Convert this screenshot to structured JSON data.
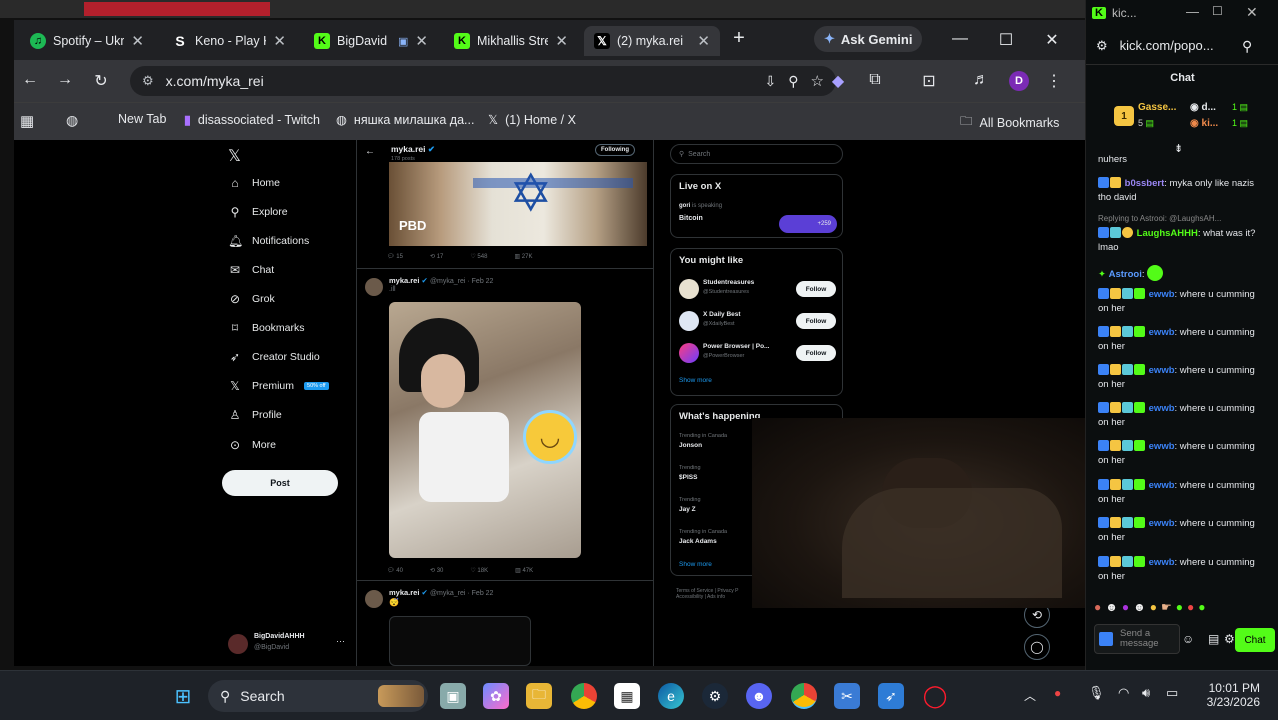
{
  "browser": {
    "tabs": [
      {
        "label": "Spotify – Ukr",
        "icon": "spotify-icon",
        "color": "#1db954",
        "glyph": "♫"
      },
      {
        "label": "Keno - Play K",
        "icon": "stake-icon",
        "color": "#2f3640",
        "glyph": "S"
      },
      {
        "label": "BigDavid",
        "icon": "kick-icon",
        "color": "#53fc18",
        "glyph": "K"
      },
      {
        "label": "Mikhallis Stre",
        "icon": "kick-icon",
        "color": "#53fc18",
        "glyph": "K"
      },
      {
        "label": "(2) myka.rei",
        "icon": "x-icon",
        "color": "#000000",
        "glyph": "𝕏"
      }
    ],
    "new_tab_glyph": "+",
    "ask_gemini": "Ask Gemini",
    "url": "x.com/myka_rei",
    "profile_initial": "D",
    "bookmarks": [
      {
        "label": "New Tab",
        "icon": "globe-icon"
      },
      {
        "label": "disassociated - Twitch",
        "icon": "twitch-icon"
      },
      {
        "label": "няшка милашка да...",
        "icon": "globe-icon"
      },
      {
        "label": "(1) Home / X",
        "icon": "x-icon"
      }
    ],
    "all_bookmarks": "All Bookmarks"
  },
  "x": {
    "nav": [
      "Home",
      "Explore",
      "Notifications",
      "Chat",
      "Grok",
      "Bookmarks",
      "Creator Studio",
      "Premium",
      "Profile",
      "More"
    ],
    "premium_badge": "50% off",
    "post_button": "Post",
    "account_name": "BigDavidAHHH",
    "account_handle": "@BigDavid",
    "profile_header": {
      "name": "myka.rei",
      "posts": "178 posts",
      "following_button": "Following"
    },
    "image_watermark": "PBD",
    "tweet1_stats": [
      "15",
      "17",
      "548",
      "27K"
    ],
    "tweet2": {
      "name": "myka.rei",
      "handle": "@myka_rei · Feb 22",
      "text": ".ill",
      "stats": [
        "40",
        "30",
        "18K",
        "47K"
      ]
    },
    "tweet3": {
      "name": "myka.rei",
      "handle": "@myka_rei · Feb 22",
      "text": "😴"
    },
    "search_placeholder": "Search",
    "live": {
      "title": "Live on X",
      "host": "gori",
      "host_status": "is speaking",
      "topic": "Bitcoin",
      "count": "+259"
    },
    "might_like": {
      "title": "You might like",
      "users": [
        {
          "name": "Studentreasures",
          "handle": "@Studentreasures"
        },
        {
          "name": "X Daily Best",
          "handle": "@XdailyBest"
        },
        {
          "name": "Power Browser | Po...",
          "handle": "@PowerBrowser"
        }
      ],
      "follow": "Follow",
      "show_more": "Show more"
    },
    "happening": {
      "title": "What's happening",
      "items": [
        {
          "context": "Trending in Canada",
          "topic": "Jonson"
        },
        {
          "context": "Trending",
          "topic": "$PISS"
        },
        {
          "context": "Trending",
          "topic": "Jay Z"
        },
        {
          "context": "Trending in Canada",
          "topic": "Jack Adams"
        }
      ],
      "show_more": "Show more"
    },
    "footer": [
      "Terms of Service",
      "Privacy P",
      "Accessibility",
      "Ads info"
    ]
  },
  "chat": {
    "window_title": "kic...",
    "url": "kick.com/popo...",
    "title": "Chat",
    "leader": {
      "rank": "1",
      "name": "Gasse...",
      "amount": "5",
      "second": "d...",
      "third": "ki...",
      "gift1": "1",
      "gift2": "1"
    },
    "messages": [
      {
        "user": "",
        "text": "nuhers",
        "ucolor": "#e5e7eb"
      },
      {
        "user": "b0ssbert",
        "text": "myka only like nazis tho david",
        "ucolor": "#9b87f5"
      },
      {
        "reply": "Replying to Astrooi: @LaughsAH...",
        "user": "LaughsAHHH",
        "text": "what was it? lmao",
        "ucolor": "#53fc18"
      },
      {
        "user": "Astrooi",
        "text": "",
        "ucolor": "#5b9bff"
      },
      {
        "user": "ewwb",
        "text": "where u cumming on her",
        "ucolor": "#3b82f6"
      },
      {
        "user": "ewwb",
        "text": "where u cumming on her",
        "ucolor": "#3b82f6"
      },
      {
        "user": "ewwb",
        "text": "where u cumming on her",
        "ucolor": "#3b82f6"
      },
      {
        "user": "ewwb",
        "text": "where u cumming on her",
        "ucolor": "#3b82f6"
      },
      {
        "user": "ewwb",
        "text": "where u cumming on her",
        "ucolor": "#3b82f6"
      },
      {
        "user": "ewwb",
        "text": "where u cumming on her",
        "ucolor": "#3b82f6"
      },
      {
        "user": "ewwb",
        "text": "where u cumming on her",
        "ucolor": "#3b82f6"
      },
      {
        "user": "ewwb",
        "text": "where u cumming on her",
        "ucolor": "#3b82f6"
      }
    ],
    "input_placeholder": "Send a message",
    "send_button": "Chat"
  },
  "taskbar": {
    "search": "Search",
    "time": "10:01 PM",
    "date": "3/23/2026"
  },
  "colors": {
    "kick_green": "#53fc18",
    "x_blue": "#1d9bf0",
    "premium_blue": "#1d9bf0"
  }
}
